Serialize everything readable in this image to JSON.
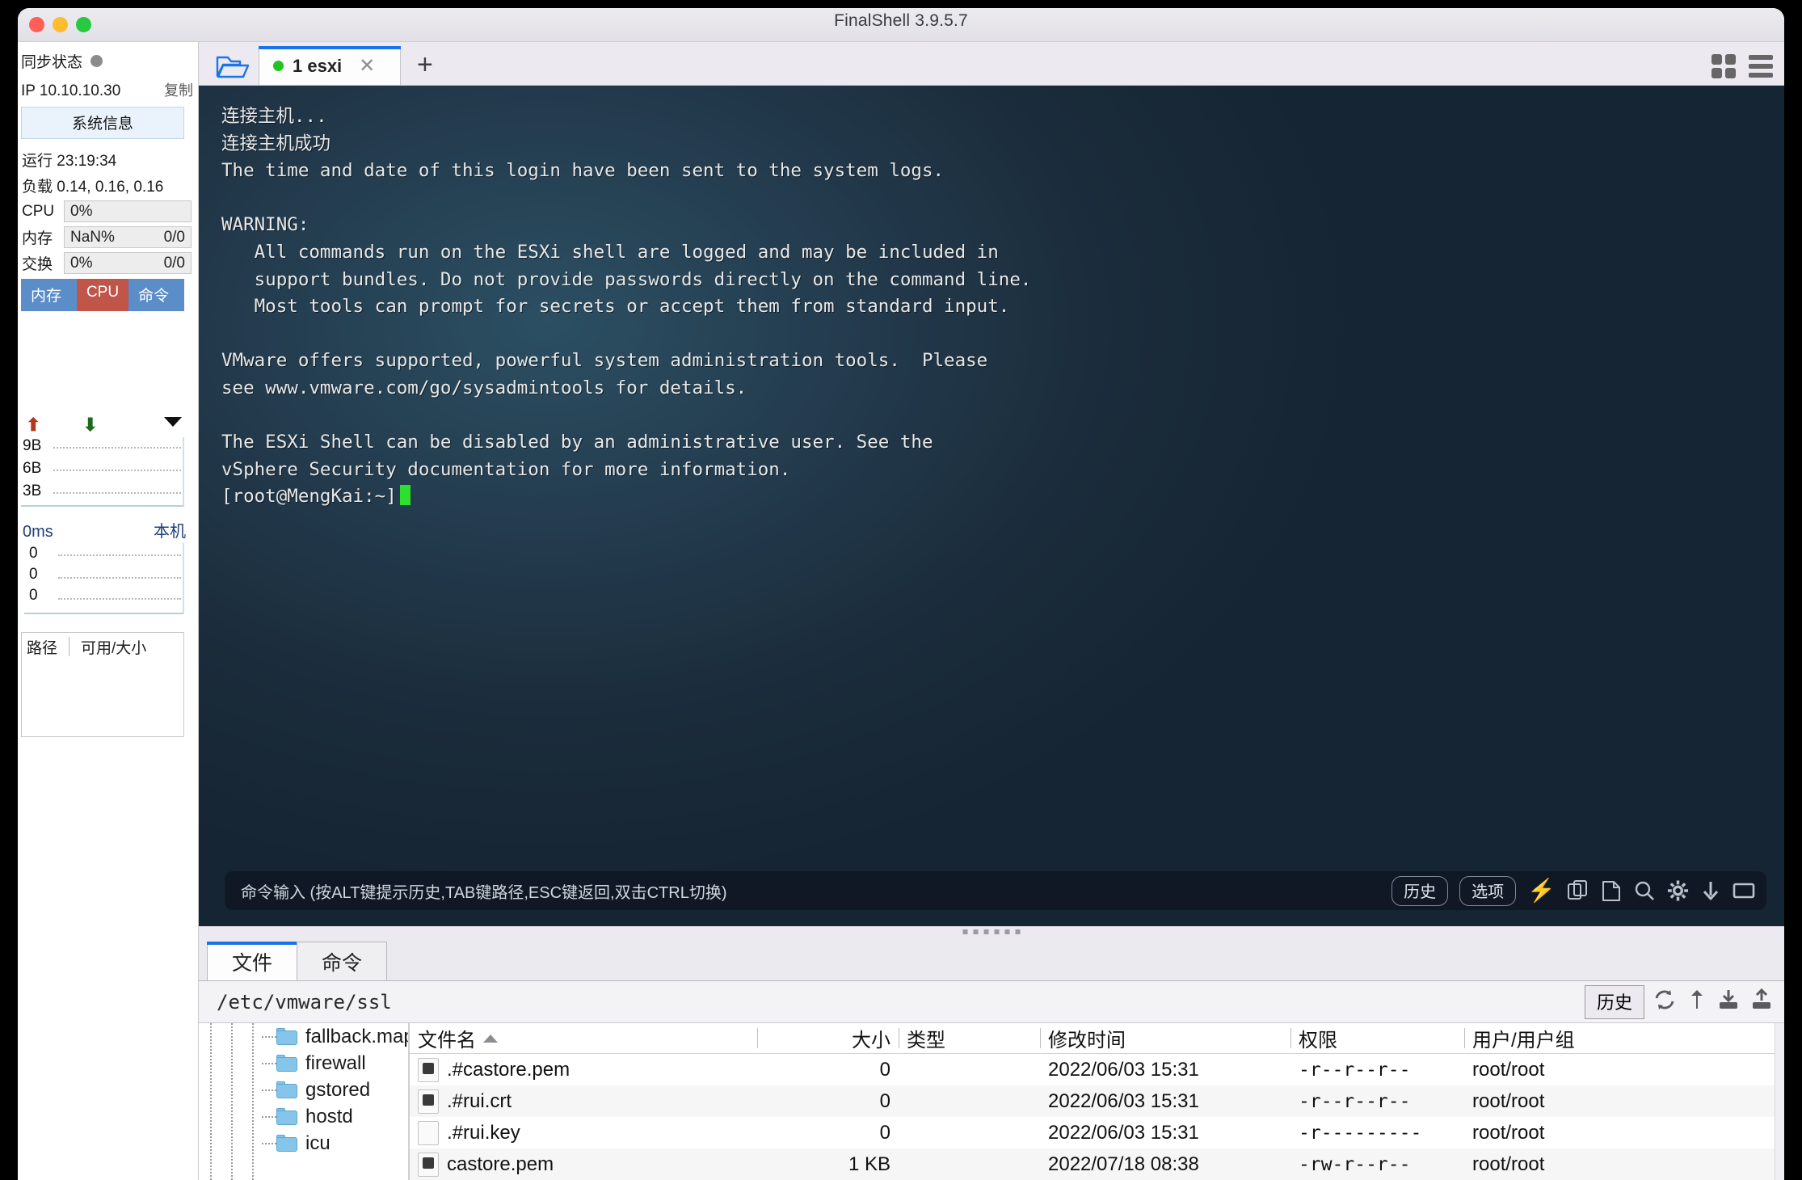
{
  "window": {
    "title": "FinalShell 3.9.5.7",
    "traffic_lights": [
      "close",
      "minimize",
      "zoom"
    ]
  },
  "sidebar": {
    "sync_status_label": "同步状态",
    "ip_label": "IP 10.10.10.30",
    "copy_label": "复制",
    "sysinfo_button": "系统信息",
    "uptime_line": "运行 23:19:34",
    "load_line": "负载 0.14, 0.16, 0.16",
    "meters": [
      {
        "label": "CPU",
        "value": "0%",
        "right": ""
      },
      {
        "label": "内存",
        "value": "NaN%",
        "right": "0/0"
      },
      {
        "label": "交换",
        "value": "0%",
        "right": "0/0"
      }
    ],
    "tabs": [
      {
        "label": "内存",
        "active": false
      },
      {
        "label": "CPU",
        "active": true
      },
      {
        "label": "命令",
        "active": false
      }
    ],
    "net": {
      "up_icon": "arrow-up-icon",
      "down_icon": "arrow-down-icon",
      "menu_icon": "chevron-down-icon",
      "y_labels": [
        "9B",
        "6B",
        "3B"
      ]
    },
    "latency": {
      "value": "0ms",
      "target": "本机",
      "y_labels": [
        "0",
        "0",
        "0"
      ]
    },
    "disk": {
      "col_path": "路径",
      "col_avail": "可用/大小",
      "rows": []
    }
  },
  "tabbar": {
    "open_folder_icon": "open-folder-icon",
    "tabs": [
      {
        "label": "1 esxi",
        "connected": true,
        "close_icon": "close-icon"
      }
    ],
    "new_tab_icon": "plus-icon",
    "grid_view_icon": "grid-view-icon",
    "list_view_icon": "list-view-icon"
  },
  "terminal": {
    "lines": [
      "连接主机...",
      "连接主机成功",
      "The time and date of this login have been sent to the system logs.",
      "",
      "WARNING:",
      "   All commands run on the ESXi shell are logged and may be included in",
      "   support bundles. Do not provide passwords directly on the command line.",
      "   Most tools can prompt for secrets or accept them from standard input.",
      "",
      "VMware offers supported, powerful system administration tools.  Please",
      "see www.vmware.com/go/sysadmintools for details.",
      "",
      "The ESXi Shell can be disabled by an administrative user. See the",
      "vSphere Security documentation for more information."
    ],
    "prompt": "[root@MengKai:~]",
    "command_bar": {
      "placeholder": "命令输入 (按ALT键提示历史,TAB键路径,ESC键返回,双击CTRL切换)",
      "history_label": "历史",
      "options_label": "选项",
      "icons": [
        "bolt-icon",
        "copy-icon",
        "paste-icon",
        "search-icon",
        "gear-icon",
        "download-icon",
        "window-icon"
      ]
    }
  },
  "filemanager": {
    "tabs": [
      {
        "label": "文件",
        "active": true
      },
      {
        "label": "命令",
        "active": false
      }
    ],
    "path": "/etc/vmware/ssl",
    "history_label": "历史",
    "toolbar_icons": [
      "refresh-icon",
      "up-folder-icon",
      "download-icon",
      "upload-icon"
    ],
    "tree": [
      {
        "label": "fallback.map",
        "icon": "folder-icon"
      },
      {
        "label": "firewall",
        "icon": "folder-icon"
      },
      {
        "label": "gstored",
        "icon": "folder-icon"
      },
      {
        "label": "hostd",
        "icon": "folder-icon"
      },
      {
        "label": "icu",
        "icon": "folder-icon"
      }
    ],
    "columns": [
      "文件名",
      "大小",
      "类型",
      "修改时间",
      "权限",
      "用户/用户组"
    ],
    "sort_column": "文件名",
    "sort_dir": "asc",
    "rows": [
      {
        "name": ".#castore.pem",
        "icon": "cert-file-icon",
        "size": "0",
        "type": "",
        "mtime": "2022/06/03 15:31",
        "perm": "-r--r--r--",
        "owner": "root/root"
      },
      {
        "name": ".#rui.crt",
        "icon": "cert-file-icon",
        "size": "0",
        "type": "",
        "mtime": "2022/06/03 15:31",
        "perm": "-r--r--r--",
        "owner": "root/root"
      },
      {
        "name": ".#rui.key",
        "icon": "plain-file-icon",
        "size": "0",
        "type": "",
        "mtime": "2022/06/03 15:31",
        "perm": "-r---------",
        "owner": "root/root"
      },
      {
        "name": "castore.pem",
        "icon": "cert-file-icon",
        "size": "1 KB",
        "type": "",
        "mtime": "2022/07/18 08:38",
        "perm": "-rw-r--r--",
        "owner": "root/root"
      }
    ]
  },
  "colors": {
    "accent": "#1a73e8",
    "tab_mem": "#5b8dc8",
    "tab_cpu": "#c0554a",
    "prompt_cursor": "#2ee02e",
    "terminal_bg": "#1a2b3a"
  }
}
